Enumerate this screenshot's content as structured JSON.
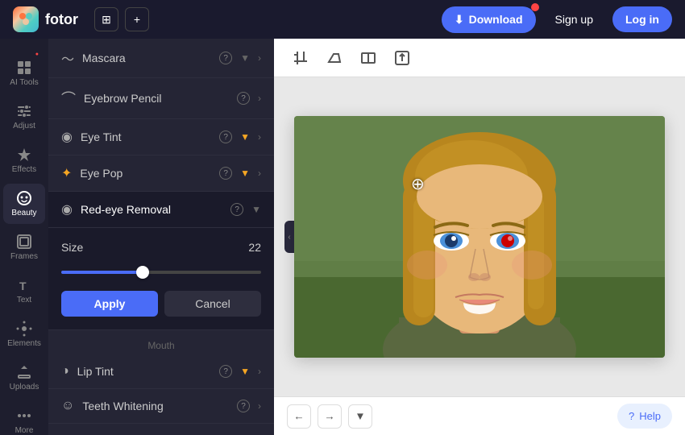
{
  "header": {
    "logo_text": "fotor",
    "download_label": "Download",
    "signup_label": "Sign up",
    "login_label": "Log in"
  },
  "icon_sidebar": {
    "items": [
      {
        "id": "ai-tools",
        "label": "AI Tools",
        "icon": "✦",
        "has_dot": true
      },
      {
        "id": "adjust",
        "label": "Adjust",
        "icon": "⊞",
        "has_dot": false
      },
      {
        "id": "effects",
        "label": "Effects",
        "icon": "✦",
        "has_dot": false
      },
      {
        "id": "beauty",
        "label": "Beauty",
        "icon": "◎",
        "active": true,
        "has_dot": false
      },
      {
        "id": "frames",
        "label": "Frames",
        "icon": "⬜",
        "has_dot": false
      },
      {
        "id": "text",
        "label": "Text",
        "icon": "T",
        "has_dot": false
      },
      {
        "id": "elements",
        "label": "Elements",
        "icon": "❋",
        "has_dot": false
      },
      {
        "id": "uploads",
        "label": "Uploads",
        "icon": "⬆",
        "has_dot": false
      },
      {
        "id": "more",
        "label": "More",
        "icon": "•••",
        "has_dot": false
      }
    ]
  },
  "panel": {
    "items": [
      {
        "id": "mascara",
        "label": "Mascara",
        "icon": "~",
        "has_star": false,
        "has_arrow": true
      },
      {
        "id": "eyebrow-pencil",
        "label": "Eyebrow Pencil",
        "icon": "⌒",
        "has_star": false,
        "has_arrow": true
      },
      {
        "id": "eye-tint",
        "label": "Eye Tint",
        "icon": "◉",
        "has_star": true,
        "has_arrow": true
      },
      {
        "id": "eye-pop",
        "label": "Eye Pop",
        "icon": "✦",
        "has_star": true,
        "has_arrow": true
      },
      {
        "id": "red-eye-removal",
        "label": "Red-eye Removal",
        "icon": "◉",
        "active": true,
        "has_star": false,
        "has_arrow": false,
        "expanded": true
      }
    ],
    "expanded": {
      "size_label": "Size",
      "size_value": "22",
      "slider_value": 40,
      "apply_label": "Apply",
      "cancel_label": "Cancel"
    },
    "mouth_section": {
      "label": "Mouth",
      "items": [
        {
          "id": "lip-tint",
          "label": "Lip Tint",
          "icon": "◑",
          "has_star": true,
          "has_arrow": true
        },
        {
          "id": "teeth-whitening",
          "label": "Teeth Whitening",
          "icon": "☺",
          "has_star": false,
          "has_arrow": true
        }
      ]
    }
  },
  "canvas": {
    "toolbar_icons": [
      "crop",
      "eraser",
      "compare",
      "export"
    ],
    "help_label": "Help"
  },
  "colors": {
    "accent": "#4a6cf7",
    "active_bg": "#2a2a3e",
    "panel_bg": "#252535",
    "sidebar_bg": "#1e1e2e"
  }
}
